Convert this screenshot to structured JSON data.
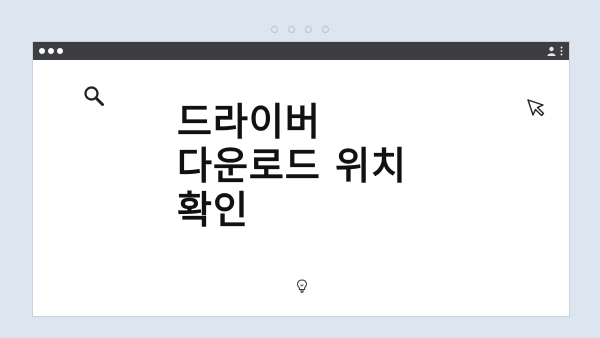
{
  "window": {
    "title_lines": [
      "드라이버",
      "다운로드 위치",
      "확인"
    ]
  },
  "icons": {
    "top_dots": "pagination-dots",
    "traffic_lights": "window-control-dots",
    "user": "user-icon",
    "menu": "kebab-menu-icon",
    "search": "search-icon",
    "cursor": "cursor-arrow-icon",
    "bulb": "lightbulb-icon"
  },
  "colors": {
    "background": "#dde6f0",
    "titlebar": "#3d3e41",
    "text": "#111111"
  }
}
